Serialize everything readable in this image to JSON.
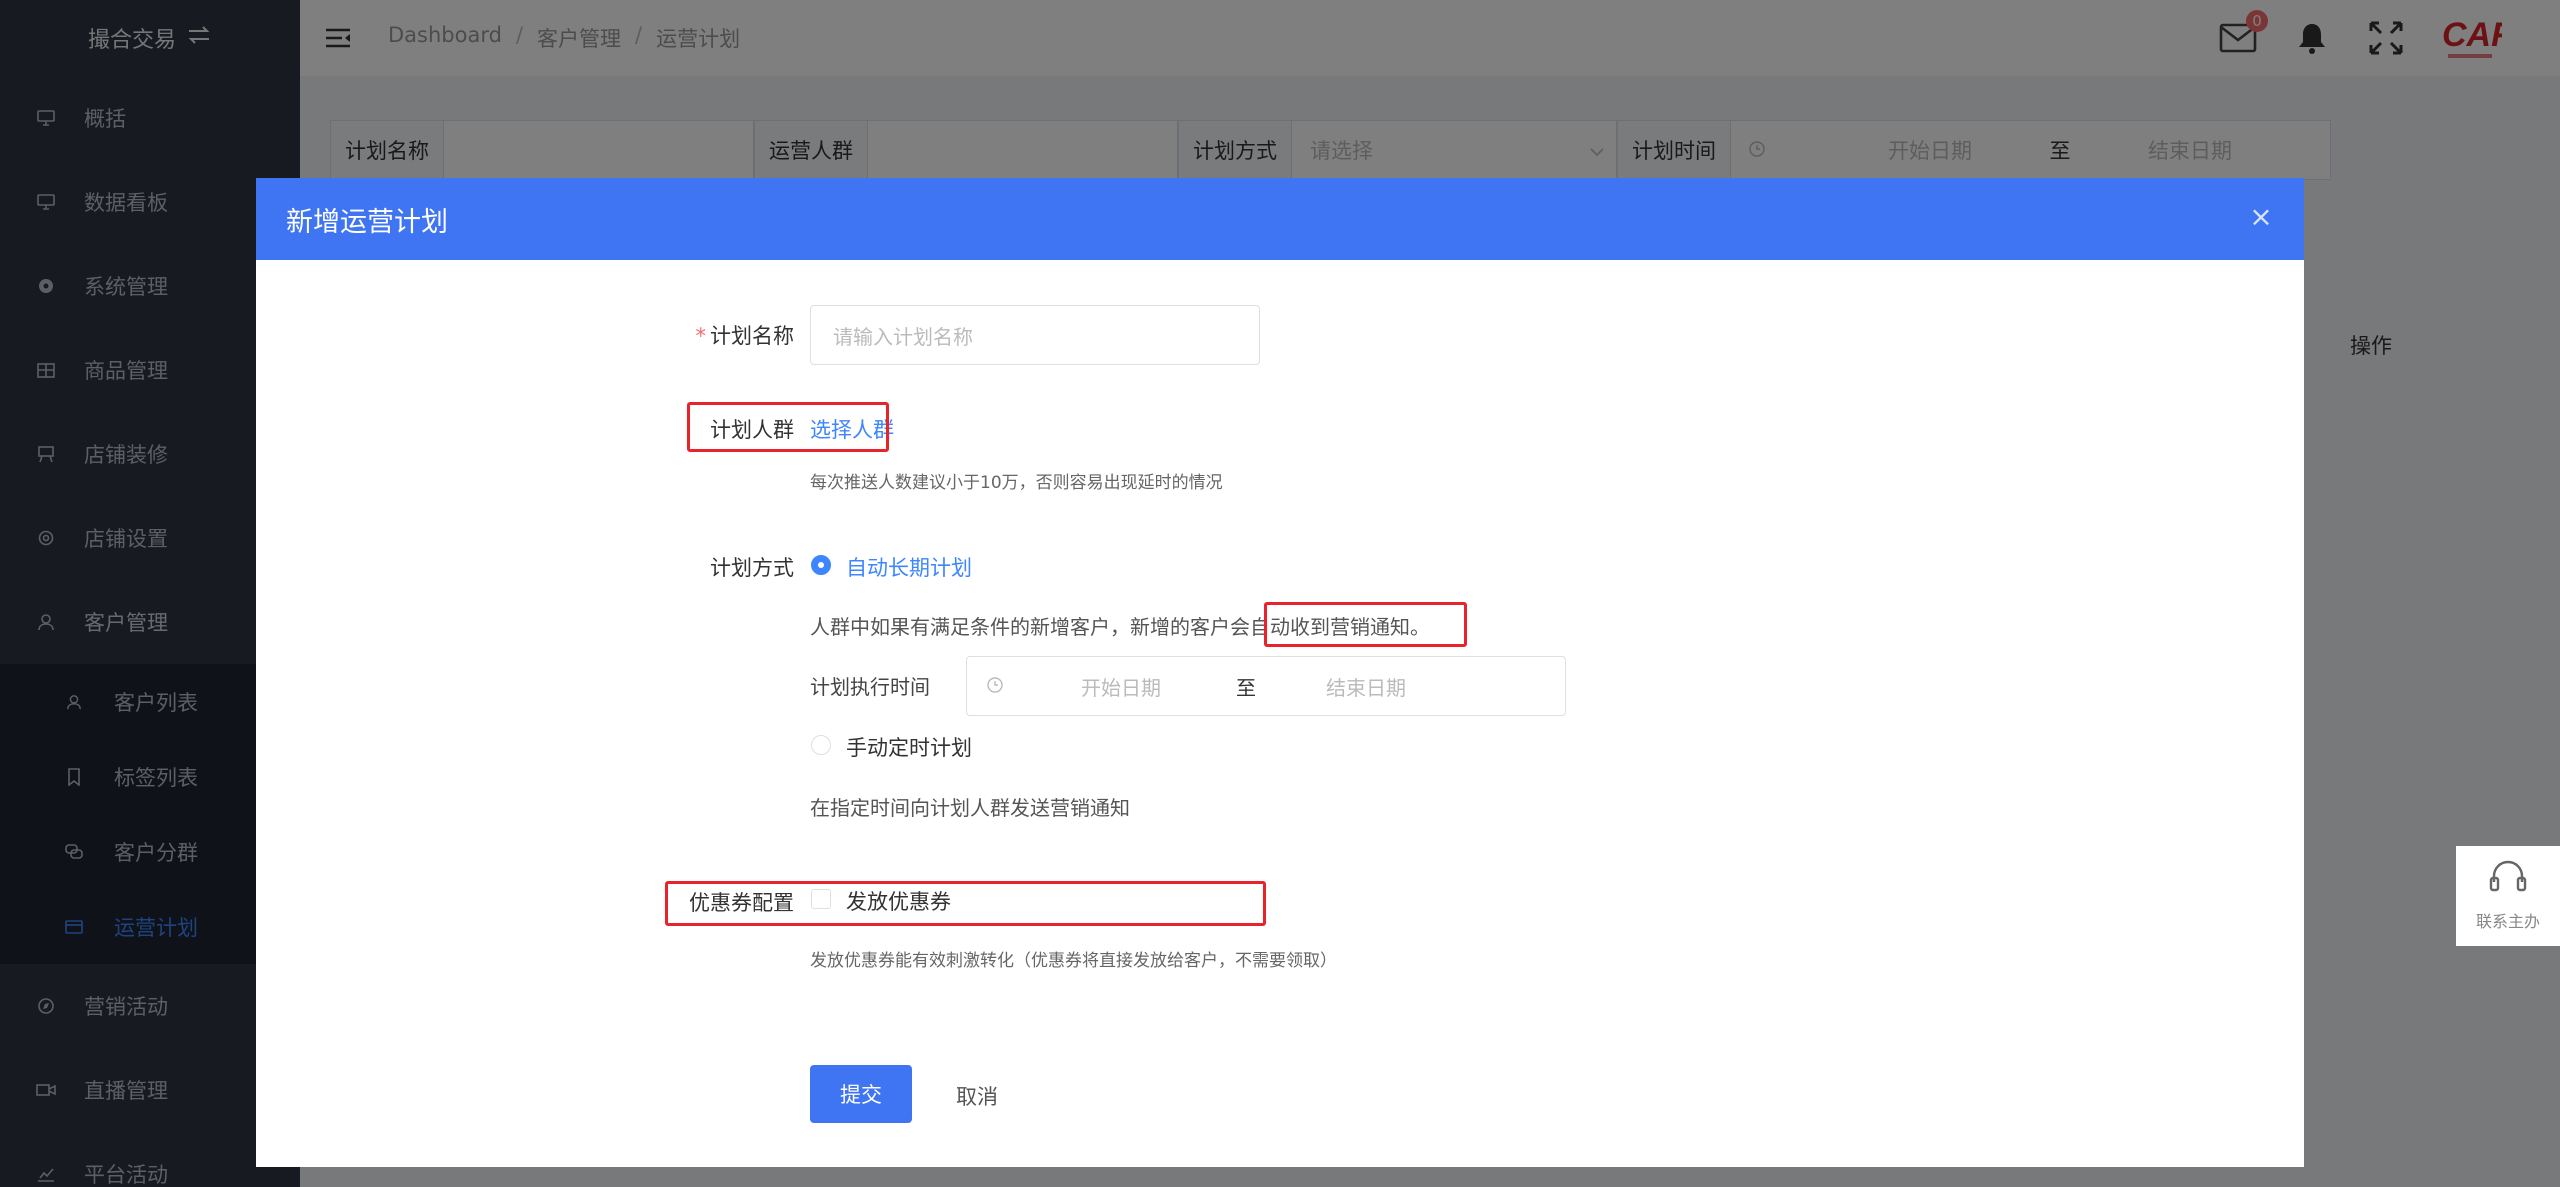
{
  "sidebar": {
    "brand": "撮合交易",
    "items": [
      {
        "label": "概括",
        "icon": "monitor-icon"
      },
      {
        "label": "数据看板",
        "icon": "monitor-icon"
      },
      {
        "label": "系统管理",
        "icon": "gear-filled-icon"
      },
      {
        "label": "商品管理",
        "icon": "grid-icon"
      },
      {
        "label": "店铺装修",
        "icon": "easel-icon"
      },
      {
        "label": "店铺设置",
        "icon": "settings-icon"
      },
      {
        "label": "客户管理",
        "icon": "user-icon"
      }
    ],
    "submenu": [
      {
        "label": "客户列表",
        "icon": "user-icon"
      },
      {
        "label": "标签列表",
        "icon": "bookmark-icon"
      },
      {
        "label": "客户分群",
        "icon": "chat-icon"
      },
      {
        "label": "运营计划",
        "icon": "card-icon"
      }
    ],
    "items_after": [
      {
        "label": "营销活动",
        "icon": "compass-icon"
      },
      {
        "label": "直播管理",
        "icon": "video-icon"
      },
      {
        "label": "平台活动",
        "icon": "chart-icon"
      }
    ]
  },
  "topbar": {
    "breadcrumb": [
      "Dashboard",
      "客户管理",
      "运营计划"
    ],
    "mail_badge": "0",
    "logo_text": "CAF"
  },
  "filter": {
    "plan_name_label": "计划名称",
    "crowd_label": "运营人群",
    "method_label": "计划方式",
    "method_placeholder": "请选择",
    "time_label": "计划时间",
    "start_placeholder": "开始日期",
    "to": "至",
    "end_placeholder": "结束日期"
  },
  "table": {
    "ops_header": "操作"
  },
  "modal": {
    "title": "新增运营计划",
    "plan_name_label": "计划名称",
    "plan_name_placeholder": "请输入计划名称",
    "crowd_label": "计划人群",
    "crowd_link": "选择人群",
    "crowd_hint": "每次推送人数建议小于10万，否则容易出现延时的情况",
    "method_label": "计划方式",
    "auto_option": "自动长期计划",
    "auto_desc_prefix": "人群中如果有满足条件的新增客户，新增的客户会",
    "auto_desc_highlight": "自动收到营销通知。",
    "exec_time_label": "计划执行时间",
    "exec_start_placeholder": "开始日期",
    "exec_to": "至",
    "exec_end_placeholder": "结束日期",
    "manual_option": "手动定时计划",
    "manual_desc": "在指定时间向计划人群发送营销通知",
    "coupon_label": "优惠券配置",
    "coupon_option": "发放优惠券",
    "coupon_hint": "发放优惠券能有效刺激转化（优惠券将直接发放给客户，不需要领取）",
    "submit": "提交",
    "cancel": "取消"
  },
  "contact": {
    "label": "联系主办"
  },
  "colors": {
    "primary": "#3f74f2",
    "sidebar": "#2f3542",
    "highlight": "#e8242a",
    "link": "#3d86ff"
  }
}
